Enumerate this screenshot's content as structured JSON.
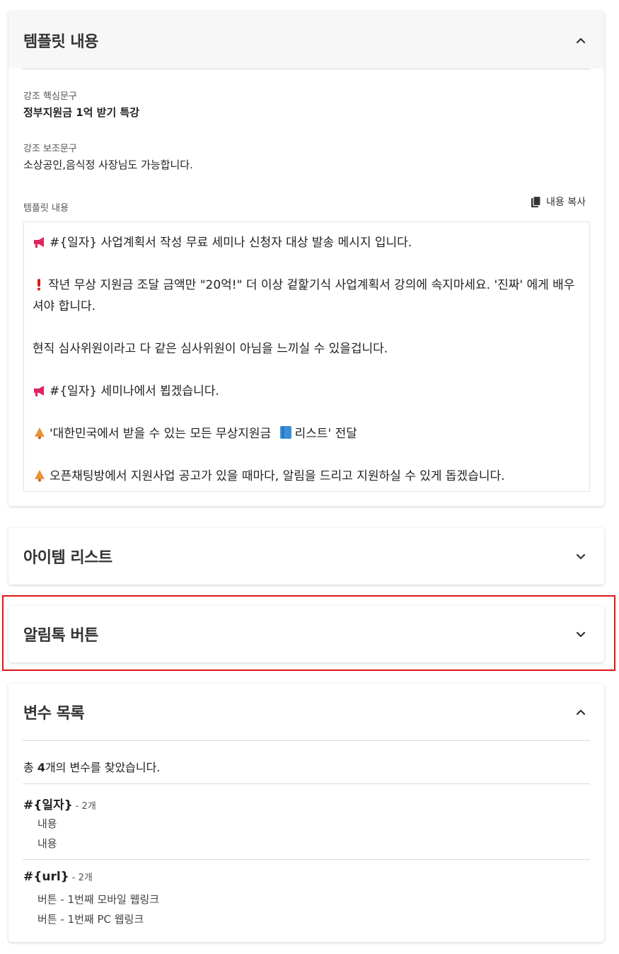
{
  "template_card": {
    "title": "템플릿 내용",
    "emphasis_main_label": "강조 핵심문구",
    "emphasis_main_value": "정부지원금 1억 받기 특강",
    "emphasis_sub_label": "강조 보조문구",
    "emphasis_sub_value": "소상공인,음식정 사장님도 가능합니다.",
    "content_label": "템플릿 내용",
    "copy_label": "내용 복사",
    "lines": [
      "#{일자} 사업계획서 작성 무료  세미나 신청자 대상 발송 메시지 입니다.",
      "작년 무상 지원금 조달 금액만 \"20억!\" 더 이상 겉핥기식 사업계획서 강의에 속지마세요. '진짜' 에게 배우셔야 합니다.",
      "현직 심사위원이라고 다 같은 심사위원이 아님을 느끼실 수 있을겁니다.",
      "#{일자}  세미나에서 뵙겠습니다.",
      "'대한민국에서 받을 수 있는 모든 무상지원금",
      "리스트' 전달",
      "오픈채팅방에서 지원사업 공고가 있을 때마다, 알림을 드리고 지원하실 수 있게 돕겠습니다."
    ]
  },
  "items_card": {
    "title": "아이템 리스트"
  },
  "buttons_card": {
    "title": "알림톡 버튼"
  },
  "vars_card": {
    "title": "변수 목록",
    "summary_prefix": "총 ",
    "summary_count": "4",
    "summary_suffix": "개의 변수를 찾았습니다.",
    "variables": [
      {
        "name": "#{일자}",
        "count": "- 2개",
        "uses": [
          "내용",
          "내용"
        ]
      },
      {
        "name": "#{url}",
        "count": "- 2개",
        "uses": [
          "버튼 - 1번째 모바일 웹링크",
          "버튼 - 1번째 PC 웹링크"
        ]
      }
    ]
  },
  "colors": {
    "highlight": "#e01515",
    "megaphone": "#e0245e",
    "exclamation": "#d81b1b",
    "bell": "#e8923a",
    "book": "#3a8fd9"
  },
  "icons": [
    "chevron-up-icon",
    "chevron-down-icon",
    "copy-icon",
    "megaphone-icon",
    "exclamation-icon",
    "bell-icon",
    "book-icon"
  ]
}
